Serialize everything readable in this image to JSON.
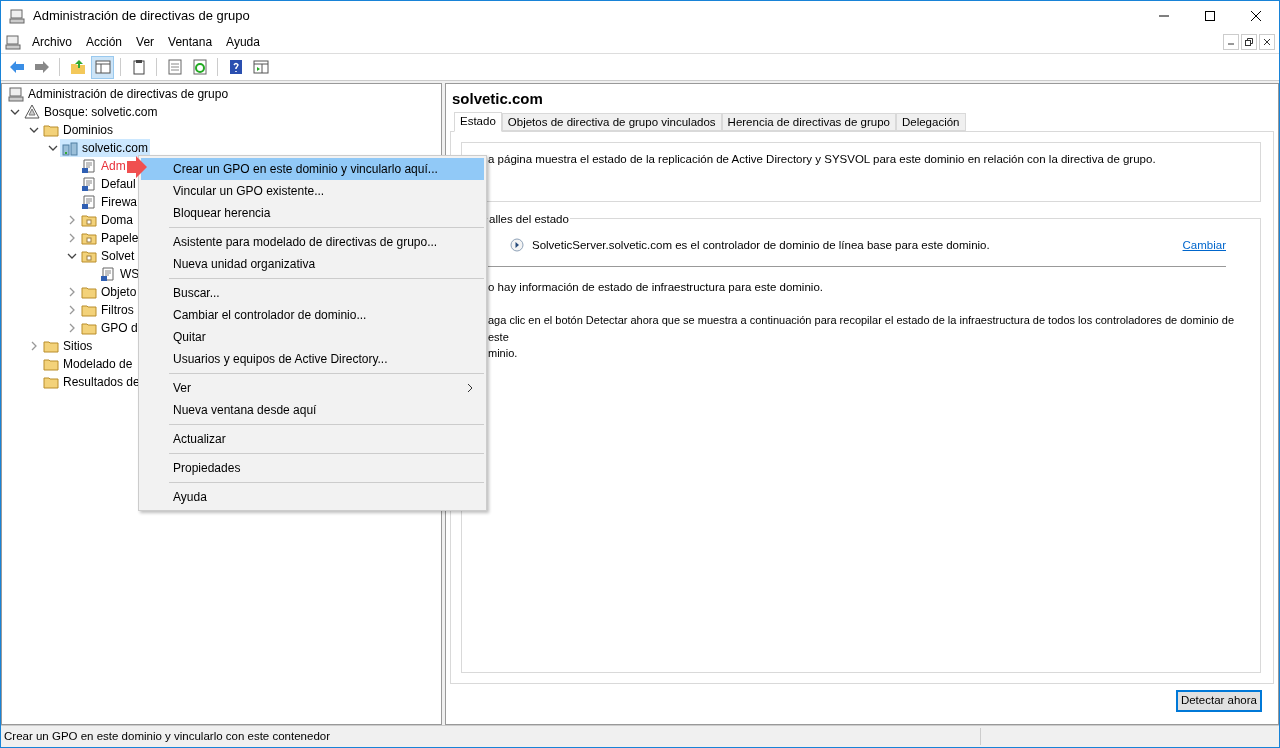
{
  "window": {
    "title": "Administración de directivas de grupo"
  },
  "menu_bar": [
    "Archivo",
    "Acción",
    "Ver",
    "Ventana",
    "Ayuda"
  ],
  "tree": {
    "root": "Administración de directivas de grupo",
    "items": [
      {
        "label": "Bosque: solvetic.com",
        "kind": "forest",
        "expanded": true,
        "selected": false,
        "children": [
          {
            "label": "Dominios",
            "kind": "folder",
            "expanded": true,
            "selected": false,
            "children": [
              {
                "label": "solvetic.com",
                "kind": "domain",
                "expanded": true,
                "selected": true,
                "children": [
                  {
                    "label": "Adm",
                    "kind": "gpo",
                    "selected": false,
                    "highlighted": true
                  },
                  {
                    "label": "Defaul",
                    "kind": "gpo",
                    "selected": false
                  },
                  {
                    "label": "Firewa",
                    "kind": "gpo",
                    "selected": false
                  },
                  {
                    "label": "Doma",
                    "kind": "ou",
                    "expanded": false,
                    "selected": false
                  },
                  {
                    "label": "Papele",
                    "kind": "ou",
                    "expanded": false,
                    "selected": false
                  },
                  {
                    "label": "Solvet",
                    "kind": "ou",
                    "expanded": true,
                    "selected": false,
                    "children": [
                      {
                        "label": "WS",
                        "kind": "gpo",
                        "selected": false
                      }
                    ]
                  },
                  {
                    "label": "Objeto",
                    "kind": "folder",
                    "expanded": false,
                    "selected": false
                  },
                  {
                    "label": "Filtros",
                    "kind": "folder",
                    "expanded": false,
                    "selected": false
                  },
                  {
                    "label": "GPO d",
                    "kind": "folder",
                    "expanded": false,
                    "selected": false
                  }
                ]
              }
            ]
          },
          {
            "label": "Sitios",
            "kind": "folder",
            "expanded": false,
            "selected": false
          },
          {
            "label": "Modelado de",
            "kind": "folder",
            "selected": false
          },
          {
            "label": "Resultados de",
            "kind": "folder",
            "selected": false
          }
        ]
      }
    ]
  },
  "context_menu": [
    {
      "kind": "item",
      "label": "Crear un GPO en este dominio y vincularlo aquí...",
      "selected": true
    },
    {
      "kind": "item",
      "label": "Vincular un GPO existente...",
      "selected": false
    },
    {
      "kind": "item",
      "label": "Bloquear herencia",
      "selected": false
    },
    {
      "kind": "separator"
    },
    {
      "kind": "item",
      "label": "Asistente para modelado de directivas de grupo...",
      "selected": false
    },
    {
      "kind": "item",
      "label": "Nueva unidad organizativa",
      "selected": false
    },
    {
      "kind": "separator"
    },
    {
      "kind": "item",
      "label": "Buscar...",
      "selected": false
    },
    {
      "kind": "item",
      "label": "Cambiar el controlador de dominio...",
      "selected": false
    },
    {
      "kind": "item",
      "label": "Quitar",
      "selected": false
    },
    {
      "kind": "item",
      "label": "Usuarios y equipos de Active Directory...",
      "selected": false
    },
    {
      "kind": "separator"
    },
    {
      "kind": "submenu",
      "label": "Ver",
      "selected": false
    },
    {
      "kind": "item",
      "label": "Nueva ventana desde aquí",
      "selected": false
    },
    {
      "kind": "separator"
    },
    {
      "kind": "item",
      "label": "Actualizar",
      "selected": false
    },
    {
      "kind": "separator"
    },
    {
      "kind": "item",
      "label": "Propiedades",
      "selected": false
    },
    {
      "kind": "separator"
    },
    {
      "kind": "item",
      "label": "Ayuda",
      "selected": false
    }
  ],
  "detail": {
    "title": "solvetic.com",
    "tabs": [
      {
        "label": "Estado",
        "selected": true
      },
      {
        "label": "Objetos de directiva de grupo vinculados",
        "selected": false
      },
      {
        "label": "Herencia de directivas de grupo",
        "selected": false
      },
      {
        "label": "Delegación",
        "selected": false
      }
    ],
    "intro": "a página muestra el estado de la replicación de Active Directory y SYSVOL para este dominio en relación con la directiva de grupo.",
    "group_title": "alles del estado",
    "baseline": "SolveticServer.solvetic.com es el controlador de dominio de línea base para este dominio.",
    "change_link": "Cambiar",
    "no_info": "o hay información de estado de infraestructura para este dominio.",
    "instructions": [
      "aga clic en el botón Detectar ahora que se muestra a continuación para recopilar el estado de la infraestructura de todos los controladores de dominio de este",
      "minio."
    ],
    "detect_button": "Detectar ahora"
  },
  "status_bar": "Crear un GPO en este dominio y vincularlo con este contenedor"
}
